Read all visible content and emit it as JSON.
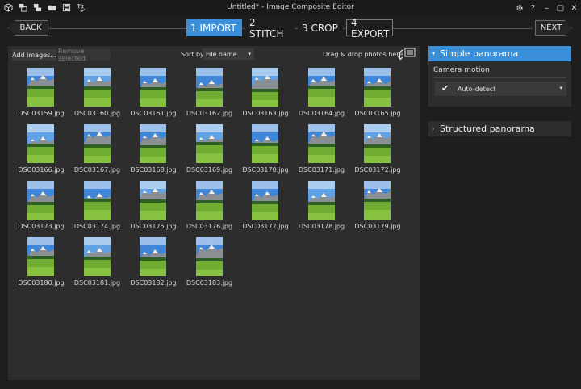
{
  "window": {
    "title": "Untitled* - Image Composite Editor",
    "controls": {
      "minimize": "–",
      "maximize": "▢",
      "close": "✕"
    }
  },
  "nav": {
    "back_label": "BACK",
    "next_label": "NEXT",
    "steps": [
      {
        "label": "1 IMPORT",
        "active": true
      },
      {
        "label": "2 STITCH",
        "active": false
      },
      {
        "label": "3 CROP",
        "active": false
      },
      {
        "label": "4 EXPORT",
        "active": false
      }
    ]
  },
  "toolbar": {
    "add_label": "Add images...",
    "remove_label": "Remove selected",
    "sort_label": "Sort by",
    "sort_value": "File name",
    "drop_text": "Drag & drop photos here"
  },
  "images": [
    "DSC03159.jpg",
    "DSC03160.jpg",
    "DSC03161.jpg",
    "DSC03162.jpg",
    "DSC03163.jpg",
    "DSC03164.jpg",
    "DSC03165.jpg",
    "DSC03166.jpg",
    "DSC03167.jpg",
    "DSC03168.jpg",
    "DSC03169.jpg",
    "DSC03170.jpg",
    "DSC03171.jpg",
    "DSC03172.jpg",
    "DSC03173.jpg",
    "DSC03174.jpg",
    "DSC03175.jpg",
    "DSC03176.jpg",
    "DSC03177.jpg",
    "DSC03178.jpg",
    "DSC03179.jpg",
    "DSC03180.jpg",
    "DSC03181.jpg",
    "DSC03182.jpg",
    "DSC03183.jpg"
  ],
  "panel": {
    "simple": {
      "title": "Simple panorama",
      "camera_motion_label": "Camera motion",
      "camera_motion_value": "Auto-detect"
    },
    "structured": {
      "title": "Structured panorama"
    }
  },
  "colors": {
    "accent": "#3b8ed8",
    "panel": "#2d2d2d",
    "background": "#1e1e1e"
  }
}
